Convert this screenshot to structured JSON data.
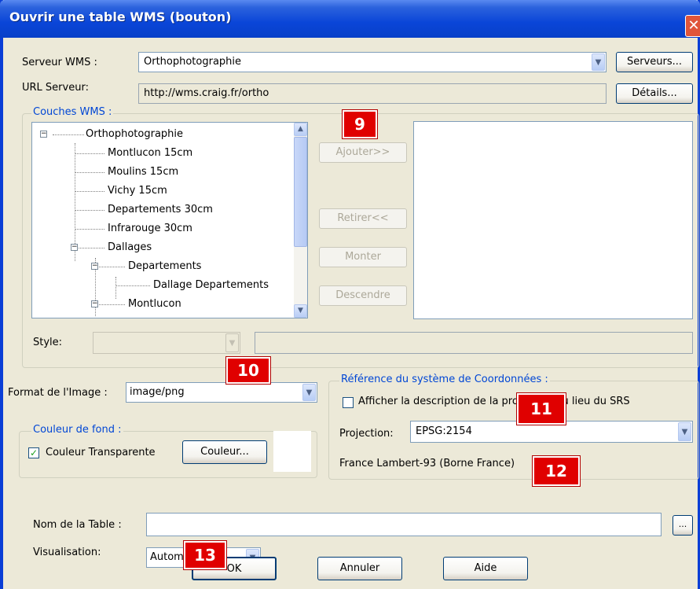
{
  "window": {
    "title": "Ouvrir une table WMS (bouton)",
    "close_glyph": "✕"
  },
  "server": {
    "label": "Serveur WMS :",
    "value": "Orthophotographie",
    "servers_button": "Serveurs...",
    "url_label": "URL Serveur:",
    "url_value": "http://wms.craig.fr/ortho",
    "details_button": "Détails..."
  },
  "layers": {
    "group_title": "Couches WMS :",
    "tree": [
      "Orthophotographie",
      "Montlucon 15cm",
      "Moulins 15cm",
      "Vichy 15cm",
      "Departements 30cm",
      "Infrarouge 30cm",
      "Dallages",
      "Departements",
      "Dallage Departements",
      "Montlucon"
    ],
    "add_button": "Ajouter>>",
    "remove_button": "Retirer<<",
    "up_button": "Monter",
    "down_button": "Descendre",
    "style_label": "Style:"
  },
  "format": {
    "label": "Format de l'Image :",
    "value": "image/png"
  },
  "background": {
    "group_title": "Couleur de fond :",
    "transparent_label": "Couleur Transparente",
    "transparent_checked": true,
    "color_button": "Couleur..."
  },
  "crs": {
    "group_title": "Référence du système de Coordonnées :",
    "show_description_label": "Afficher la description de la projection au lieu du SRS",
    "show_description_checked": false,
    "projection_label": "Projection:",
    "projection_value": "EPSG:2154",
    "description": "France Lambert-93 (Borne France)"
  },
  "table": {
    "name_label": "Nom de la Table :",
    "name_value": "",
    "browse_button": "...",
    "display_label": "Visualisation:",
    "display_value": "Autom"
  },
  "footer": {
    "ok": "OK",
    "cancel": "Annuler",
    "help": "Aide"
  },
  "callouts": [
    "9",
    "10",
    "11",
    "12",
    "13"
  ],
  "colors": {
    "titlebar": "#0a45d8",
    "dialog_bg": "#ece9d8",
    "group_title": "#0046d5",
    "callout": "#e00000"
  },
  "icons": {
    "close": "close-icon",
    "dropdown": "chevron-down-icon",
    "scroll_up": "arrow-up-icon",
    "scroll_down": "arrow-down-icon"
  }
}
